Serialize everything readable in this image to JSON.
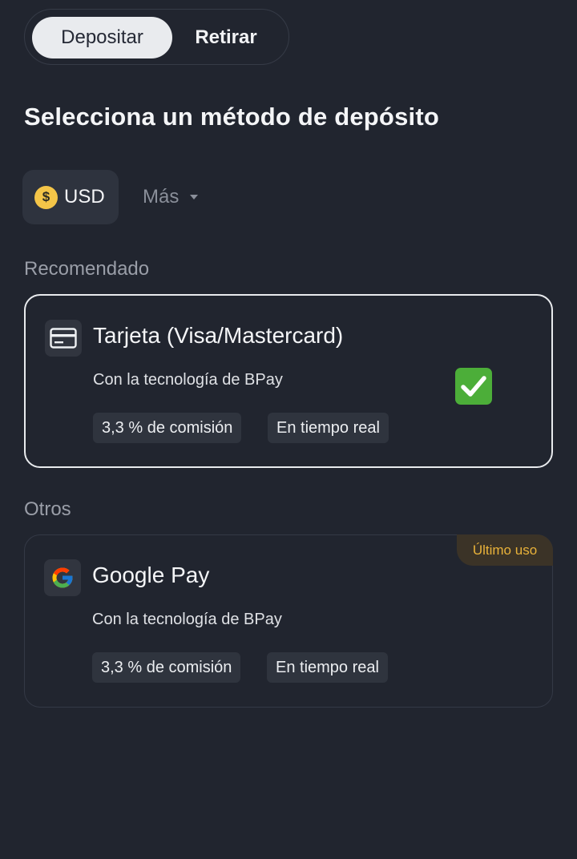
{
  "tabs": {
    "deposit_label": "Depositar",
    "withdraw_label": "Retirar",
    "active": "deposit"
  },
  "page_title": "Selecciona un método de depósito",
  "currency": {
    "symbol": "$",
    "selected": "USD",
    "more_label": "Más"
  },
  "sections": {
    "recommended_label": "Recomendado",
    "others_label": "Otros"
  },
  "methods": [
    {
      "name": "Tarjeta (Visa/Mastercard)",
      "icon": "credit-card-icon",
      "provider": "Con la tecnología de BPay",
      "fee": "3,3 % de comisión",
      "speed": "En tiempo real",
      "selected": true,
      "selected_icon": "check-mark-icon"
    },
    {
      "name": "Google Pay",
      "icon": "google-icon",
      "provider": "Con la tecnología de BPay",
      "fee": "3,3 % de comisión",
      "speed": "En tiempo real",
      "badge": "Último uso",
      "selected": false
    }
  ],
  "colors": {
    "background": "#21252f",
    "chip_background": "#2f343e",
    "selected_border": "#e9ebee",
    "badge_text": "#e9b23a",
    "badge_background": "#3b3327",
    "coin": "#f4c548",
    "check_green": "#4cae39"
  }
}
